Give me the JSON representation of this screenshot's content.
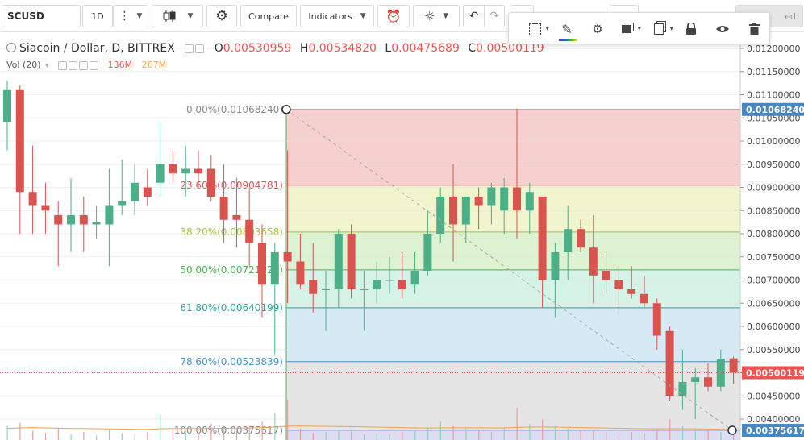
{
  "toolbar": {
    "symbol": "SCUSD",
    "interval": "1D",
    "compare_label": "Compare",
    "indicators_label": "Indicators",
    "hidden_label": "ed"
  },
  "legend": {
    "title": "Siacoin / Dollar, D, BITTREX",
    "open_label": "O",
    "open": "0.00530959",
    "high_label": "H",
    "high": "0.00534820",
    "low_label": "L",
    "low": "0.00475689",
    "close_label": "C",
    "close": "0.00500119",
    "vol_label": "Vol (20)",
    "vol_value": "136M",
    "vol_ma": "267M"
  },
  "colors": {
    "up": "#4caf87",
    "down": "#d9534f",
    "price_line": "#ef5350",
    "fib_line": "#aaaaaa"
  },
  "chart_data": {
    "type": "candlestick",
    "title": "Siacoin / Dollar, D, BITTREX",
    "price_axis": {
      "min": 0.0036,
      "max": 0.0123,
      "ticks": [
        "0.01200000",
        "0.01150000",
        "0.01100000",
        "0.01050000",
        "0.01000000",
        "0.00950000",
        "0.00900000",
        "0.00850000",
        "0.00800000",
        "0.00750000",
        "0.00700000",
        "0.00650000",
        "0.00600000",
        "0.00550000",
        "0.00500000",
        "0.00450000",
        "0.00400000"
      ]
    },
    "last_price_label": "0.00500119",
    "fib_high_label": "0.01068240",
    "fib_low_label": "0.00375617",
    "fib_levels": [
      {
        "label": "0.00%(0.01068240)",
        "price": 0.0106824,
        "color": "#999999",
        "text_color": "#888888",
        "fill": "#f4c7c7"
      },
      {
        "label": "23.60%(0.00904781)",
        "price": 0.00904781,
        "color": "#e05050",
        "text_color": "#e05050",
        "fill": "#eef3c4"
      },
      {
        "label": "38.20%(0.00803658)",
        "price": 0.00803658,
        "color": "#a0c040",
        "text_color": "#a6c13e",
        "fill": "#d6f0c9"
      },
      {
        "label": "50.00%(0.00721929)",
        "price": 0.00721929,
        "color": "#4caf50",
        "text_color": "#4caf50",
        "fill": "#cdf0e0"
      },
      {
        "label": "61.80%(0.00640199)",
        "price": 0.00640199,
        "color": "#26a69a",
        "text_color": "#26a69a",
        "fill": "#cfe6f3"
      },
      {
        "label": "78.60%(0.00523839)",
        "price": 0.00523839,
        "color": "#4a90c8",
        "text_color": "#4a90c8",
        "fill": "#e0e0e0"
      },
      {
        "label": "100.00%(0.00375617)",
        "price": 0.00375617,
        "color": "#9a9ad0",
        "text_color": "#888888",
        "fill": "#d6d6f0"
      }
    ],
    "candles": [
      {
        "o": 0.0104,
        "h": 0.0113,
        "l": 0.0098,
        "c": 0.0111
      },
      {
        "o": 0.0111,
        "h": 0.0112,
        "l": 0.008,
        "c": 0.0089
      },
      {
        "o": 0.0089,
        "h": 0.0099,
        "l": 0.008,
        "c": 0.0086
      },
      {
        "o": 0.0086,
        "h": 0.0091,
        "l": 0.008,
        "c": 0.0085
      },
      {
        "o": 0.0084,
        "h": 0.0087,
        "l": 0.0073,
        "c": 0.0082
      },
      {
        "o": 0.0082,
        "h": 0.0092,
        "l": 0.0076,
        "c": 0.0084
      },
      {
        "o": 0.0084,
        "h": 0.0088,
        "l": 0.0076,
        "c": 0.0082
      },
      {
        "o": 0.0082,
        "h": 0.0086,
        "l": 0.0079,
        "c": 0.00825
      },
      {
        "o": 0.0082,
        "h": 0.0094,
        "l": 0.0073,
        "c": 0.0086
      },
      {
        "o": 0.0086,
        "h": 0.0096,
        "l": 0.0084,
        "c": 0.0087
      },
      {
        "o": 0.0087,
        "h": 0.0095,
        "l": 0.0084,
        "c": 0.0091
      },
      {
        "o": 0.009,
        "h": 0.0094,
        "l": 0.0086,
        "c": 0.0088
      },
      {
        "o": 0.0091,
        "h": 0.0104,
        "l": 0.0088,
        "c": 0.0095
      },
      {
        "o": 0.0095,
        "h": 0.0098,
        "l": 0.0091,
        "c": 0.0093
      },
      {
        "o": 0.0093,
        "h": 0.0099,
        "l": 0.0088,
        "c": 0.0094
      },
      {
        "o": 0.0094,
        "h": 0.0098,
        "l": 0.009,
        "c": 0.0093
      },
      {
        "o": 0.0094,
        "h": 0.0097,
        "l": 0.0087,
        "c": 0.0088
      },
      {
        "o": 0.0088,
        "h": 0.0095,
        "l": 0.0078,
        "c": 0.0083
      },
      {
        "o": 0.0084,
        "h": 0.0092,
        "l": 0.0077,
        "c": 0.0083
      },
      {
        "o": 0.0083,
        "h": 0.009,
        "l": 0.0073,
        "c": 0.0078
      },
      {
        "o": 0.0078,
        "h": 0.0082,
        "l": 0.0062,
        "c": 0.0069
      },
      {
        "o": 0.0069,
        "h": 0.0078,
        "l": 0.0054,
        "c": 0.0076
      },
      {
        "o": 0.0076,
        "h": 0.0098,
        "l": 0.0065,
        "c": 0.0074
      },
      {
        "o": 0.0074,
        "h": 0.008,
        "l": 0.0068,
        "c": 0.0069
      },
      {
        "o": 0.007,
        "h": 0.0078,
        "l": 0.0063,
        "c": 0.0067
      },
      {
        "o": 0.0068,
        "h": 0.0072,
        "l": 0.0059,
        "c": 0.0068
      },
      {
        "o": 0.0068,
        "h": 0.0081,
        "l": 0.0064,
        "c": 0.008
      },
      {
        "o": 0.008,
        "h": 0.0082,
        "l": 0.0066,
        "c": 0.0068
      },
      {
        "o": 0.0068,
        "h": 0.0072,
        "l": 0.0059,
        "c": 0.0068
      },
      {
        "o": 0.0068,
        "h": 0.0074,
        "l": 0.0065,
        "c": 0.007
      },
      {
        "o": 0.007,
        "h": 0.0075,
        "l": 0.0067,
        "c": 0.007
      },
      {
        "o": 0.007,
        "h": 0.0076,
        "l": 0.0066,
        "c": 0.0068
      },
      {
        "o": 0.0069,
        "h": 0.0076,
        "l": 0.0067,
        "c": 0.0072
      },
      {
        "o": 0.0072,
        "h": 0.0085,
        "l": 0.0071,
        "c": 0.008
      },
      {
        "o": 0.008,
        "h": 0.009,
        "l": 0.0078,
        "c": 0.0088
      },
      {
        "o": 0.0088,
        "h": 0.0095,
        "l": 0.0074,
        "c": 0.0082
      },
      {
        "o": 0.0082,
        "h": 0.0088,
        "l": 0.0078,
        "c": 0.0088
      },
      {
        "o": 0.0088,
        "h": 0.009,
        "l": 0.0081,
        "c": 0.0086
      },
      {
        "o": 0.0086,
        "h": 0.0091,
        "l": 0.0082,
        "c": 0.009
      },
      {
        "o": 0.0085,
        "h": 0.0092,
        "l": 0.008,
        "c": 0.009
      },
      {
        "o": 0.009,
        "h": 0.0107,
        "l": 0.0079,
        "c": 0.0085
      },
      {
        "o": 0.0085,
        "h": 0.0091,
        "l": 0.008,
        "c": 0.0089
      },
      {
        "o": 0.0088,
        "h": 0.0088,
        "l": 0.0064,
        "c": 0.007
      },
      {
        "o": 0.007,
        "h": 0.0078,
        "l": 0.0062,
        "c": 0.0076
      },
      {
        "o": 0.0076,
        "h": 0.0086,
        "l": 0.007,
        "c": 0.0081
      },
      {
        "o": 0.0081,
        "h": 0.0083,
        "l": 0.0076,
        "c": 0.0077
      },
      {
        "o": 0.0077,
        "h": 0.0084,
        "l": 0.0065,
        "c": 0.0071
      },
      {
        "o": 0.0072,
        "h": 0.0076,
        "l": 0.0067,
        "c": 0.007
      },
      {
        "o": 0.007,
        "h": 0.0073,
        "l": 0.0063,
        "c": 0.0068
      },
      {
        "o": 0.0068,
        "h": 0.0073,
        "l": 0.0066,
        "c": 0.0067
      },
      {
        "o": 0.0067,
        "h": 0.0071,
        "l": 0.0064,
        "c": 0.0065
      },
      {
        "o": 0.0065,
        "h": 0.0066,
        "l": 0.0055,
        "c": 0.0058
      },
      {
        "o": 0.0059,
        "h": 0.006,
        "l": 0.0044,
        "c": 0.0045
      },
      {
        "o": 0.0045,
        "h": 0.0055,
        "l": 0.0042,
        "c": 0.0048
      },
      {
        "o": 0.0048,
        "h": 0.0051,
        "l": 0.004,
        "c": 0.0049
      },
      {
        "o": 0.0049,
        "h": 0.0052,
        "l": 0.0046,
        "c": 0.0047
      },
      {
        "o": 0.0047,
        "h": 0.0055,
        "l": 0.0046,
        "c": 0.0053
      },
      {
        "o": 0.00531,
        "h": 0.00535,
        "l": 0.00476,
        "c": 0.005
      }
    ],
    "volume": [
      1.2,
      1.5,
      0.8,
      0.6,
      1.0,
      0.5,
      0.7,
      0.4,
      0.9,
      0.6,
      0.5,
      0.7,
      2.2,
      1.0,
      0.8,
      0.6,
      1.4,
      1.2,
      0.9,
      1.1,
      1.6,
      2.4,
      3.5,
      1.0,
      0.6,
      0.7,
      0.9,
      0.8,
      0.5,
      0.6,
      0.5,
      0.7,
      0.8,
      1.0,
      1.6,
      1.2,
      1.0,
      0.9,
      0.7,
      1.0,
      2.8,
      1.4,
      1.8,
      1.2,
      1.0,
      0.8,
      0.9,
      0.7,
      0.6,
      0.7,
      0.6,
      1.0,
      1.8,
      1.2,
      1.0,
      0.8,
      0.7,
      0.6
    ],
    "volume_ma": [
      1.0,
      1.05,
      1.08,
      1.05,
      1.02,
      1.0,
      1.0,
      0.98,
      0.96,
      0.95,
      0.93,
      0.92,
      0.98,
      1.0,
      1.0,
      0.99,
      1.0,
      1.02,
      1.02,
      1.04,
      1.07,
      1.12,
      1.2,
      1.22,
      1.2,
      1.18,
      1.17,
      1.16,
      1.14,
      1.12,
      1.1,
      1.08,
      1.05,
      1.04,
      1.05,
      1.06,
      1.06,
      1.06,
      1.05,
      1.05,
      1.1,
      1.12,
      1.13,
      1.12,
      1.1,
      1.08,
      1.06,
      1.04,
      1.02,
      1.0,
      0.98,
      0.97,
      0.98,
      0.98,
      0.97,
      0.95,
      0.93,
      0.9
    ]
  },
  "drawing_toolbar": {
    "icons": [
      "selection-frame-icon",
      "pencil-color-icon",
      "settings-icon",
      "layers-icon",
      "clone-icon",
      "lock-icon",
      "eye-icon",
      "trash-icon"
    ]
  }
}
